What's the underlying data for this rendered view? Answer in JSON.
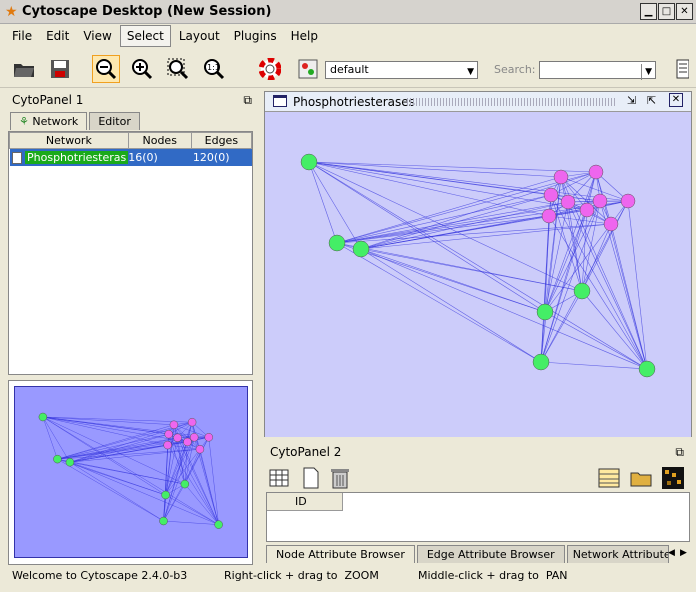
{
  "window": {
    "title": "Cytoscape Desktop (New Session)"
  },
  "menu": [
    "File",
    "Edit",
    "View",
    "Select",
    "Layout",
    "Plugins",
    "Help"
  ],
  "toolbar": {
    "style_value": "default",
    "search_label": "Search:",
    "search_value": ""
  },
  "cytopanel1": {
    "title": "CytoPanel 1",
    "tabs": [
      "Network",
      "Editor"
    ],
    "table": {
      "headers": [
        "Network",
        "Nodes",
        "Edges"
      ],
      "rows": [
        {
          "name": "Phosphotriesteras",
          "nodes": "16(0)",
          "edges": "120(0)"
        }
      ]
    }
  },
  "network_view": {
    "title": "Phosphotriesterases"
  },
  "cytopanel2": {
    "title": "CytoPanel 2",
    "column": "ID",
    "tabs": [
      "Node Attribute Browser",
      "Edge Attribute Browser",
      "Network Attribute"
    ]
  },
  "status": {
    "left": "Welcome to Cytoscape 2.4.0-b3",
    "middle": "Right-click + drag to  ZOOM",
    "right": "Middle-click + drag to  PAN"
  },
  "colors": {
    "green_node": "#44ee66",
    "pink_node": "#ee66ee",
    "edge": "#3333dd",
    "canvas": "#ccccfa",
    "selection": "#316ac5"
  }
}
